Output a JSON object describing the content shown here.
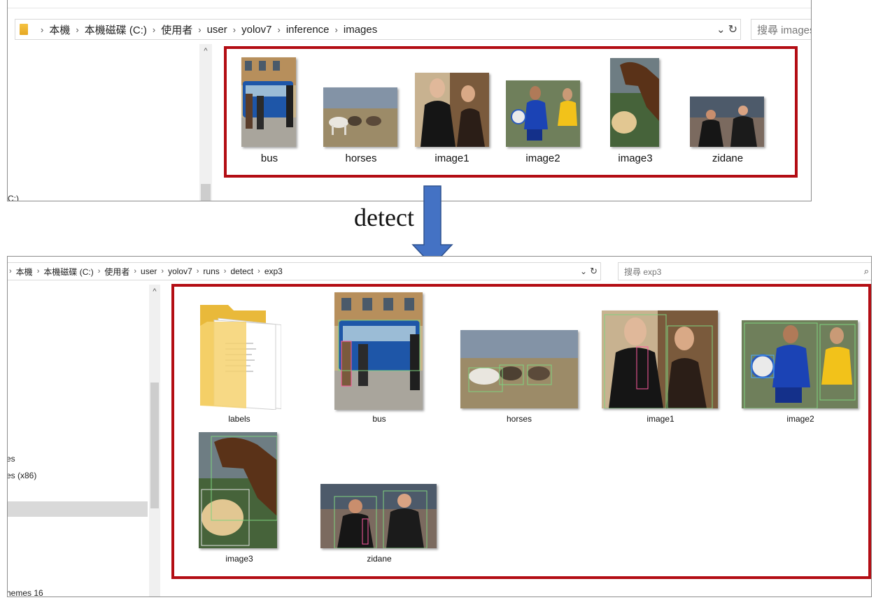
{
  "top_window": {
    "address": {
      "crumbs": [
        "本機",
        "本機磁碟 (C:)",
        "使用者",
        "user",
        "yolov7",
        "inference",
        "images"
      ],
      "separator": "›",
      "dropdown_icon": "⌄",
      "refresh_icon": "↻"
    },
    "search_placeholder": "搜尋 images",
    "nav_partial_text": "(C:)",
    "files": [
      "bus",
      "horses",
      "image1",
      "image2",
      "image3",
      "zidane"
    ]
  },
  "arrow_label": "detect",
  "bottom_window": {
    "address": {
      "crumbs": [
        "本機",
        "本機磁碟 (C:)",
        "使用者",
        "user",
        "yolov7",
        "runs",
        "detect",
        "exp3"
      ],
      "separator": "›",
      "dropdown_icon": "⌄",
      "refresh_icon": "↻"
    },
    "search_placeholder": "搜尋 exp3",
    "search_icon": "⌕",
    "nav_items": [
      "es",
      "es (x86)",
      "hemes 16"
    ],
    "files": [
      "labels",
      "bus",
      "horses",
      "image1",
      "image2",
      "image3",
      "zidane"
    ]
  },
  "colors": {
    "highlight_box": "#b30d14",
    "arrow_fill": "#4472c4",
    "arrow_stroke": "#2f528f"
  }
}
